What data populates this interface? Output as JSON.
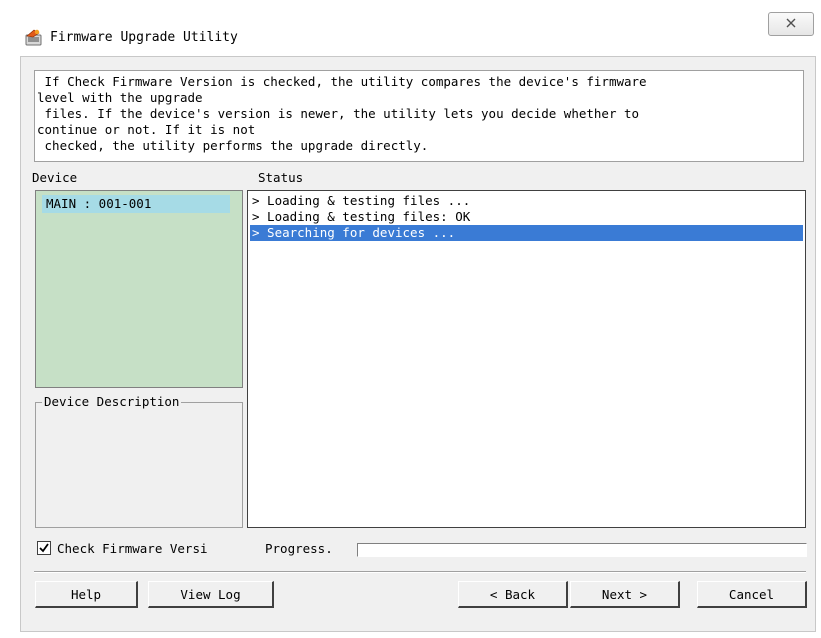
{
  "window": {
    "title": "Firmware Upgrade Utility",
    "icons": {
      "app": "firmware-app-icon",
      "close": "close-icon"
    }
  },
  "info": {
    "text": " If Check Firmware Version is checked, the utility compares the device's firmware\nlevel with the upgrade\n files. If the device's version is newer, the utility lets you decide whether to\ncontinue or not. If it is not\n checked, the utility performs the upgrade directly."
  },
  "labels": {
    "device": "Device",
    "status": "Status",
    "device_description": "Device Description",
    "check_firmware": "Check Firmware Versi",
    "progress": "Progress."
  },
  "device_list": {
    "items": [
      {
        "label": "MAIN : 001-001",
        "selected": true
      }
    ]
  },
  "status_lines": [
    {
      "text": "> Loading & testing files ...",
      "selected": false
    },
    {
      "text": "> Loading & testing files: OK",
      "selected": false
    },
    {
      "text": "> Searching for devices ...",
      "selected": true
    }
  ],
  "check_firmware_checked": true,
  "progress_value": 0,
  "buttons": {
    "help": "Help",
    "view_log": "View Log",
    "back": "< Back",
    "next": "Next >",
    "cancel": "Cancel"
  },
  "colors": {
    "device_list_bg": "#c6e0c6",
    "device_item_selected": "#a6dbe6",
    "status_selected": "#3a7bd5"
  }
}
